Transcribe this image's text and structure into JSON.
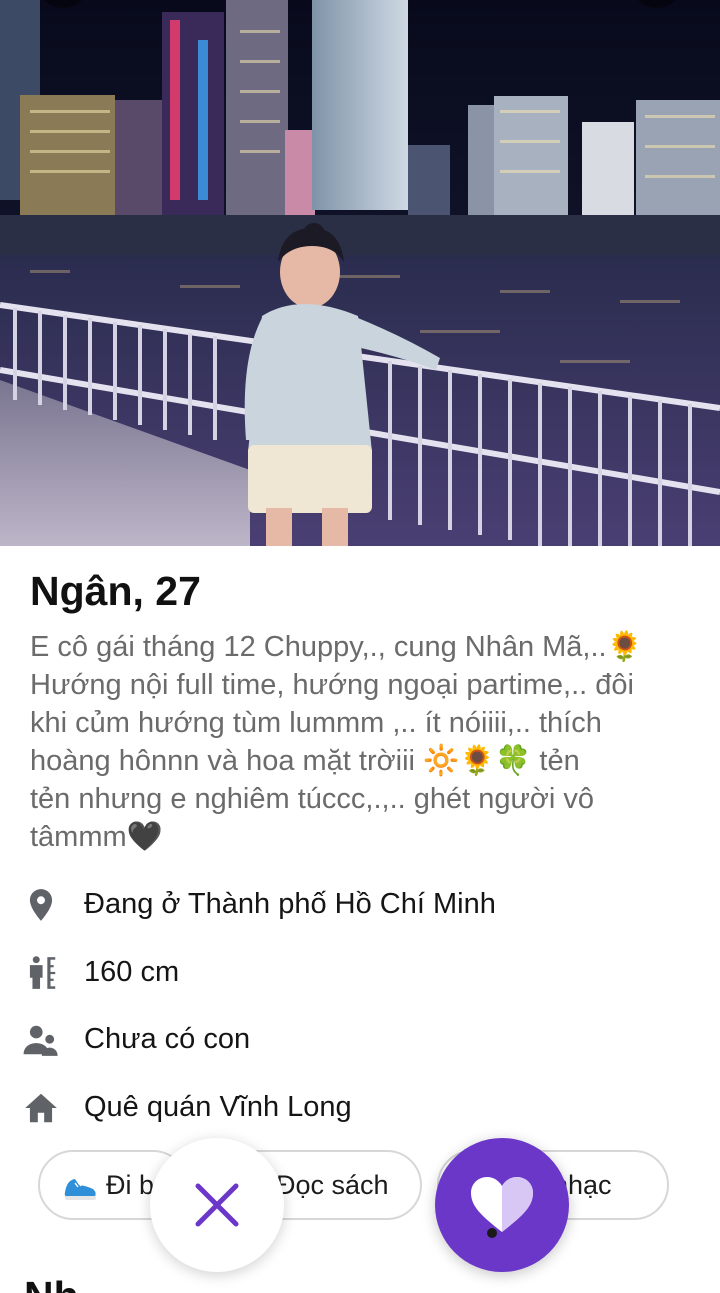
{
  "profile": {
    "name_age": "Ngân, 27",
    "bio_lines": [
      "E cô gái tháng 12 Chuppy,., cung Nhân Mã,..🌻",
      "Hướng nội full time, hướng ngoại partime,.. đôi",
      "khi củm hướng tùm lummm ,.. ít nóiiii,.. thích",
      "hoàng hônnn và hoa mặt trờiii 🔆🌻🍀 tẻn",
      "tẻn nhưng e nghiêm túccc,.,.. ghét người vô",
      "tâmmm🖤"
    ]
  },
  "info": [
    {
      "icon": "location-pin-icon",
      "text": "Đang ở Thành phố Hồ Chí Minh"
    },
    {
      "icon": "height-icon",
      "text": "160 cm"
    },
    {
      "icon": "children-icon",
      "text": "Chưa có con"
    },
    {
      "icon": "home-icon",
      "text": "Quê quán Vĩnh Long"
    }
  ],
  "interests": [
    {
      "icon": "running-shoe-icon",
      "label": "Đi b"
    },
    {
      "label": "Đọc sách"
    },
    {
      "label": "nhạc"
    }
  ],
  "actions": {
    "pass": "close-icon",
    "like": "heart-icon"
  },
  "next_section_heading_partial": "Nh",
  "colors": {
    "accent": "#6b37c9",
    "text_primary": "#111111",
    "text_secondary": "#6b6b6b",
    "chip_border": "#d7d7d7"
  }
}
